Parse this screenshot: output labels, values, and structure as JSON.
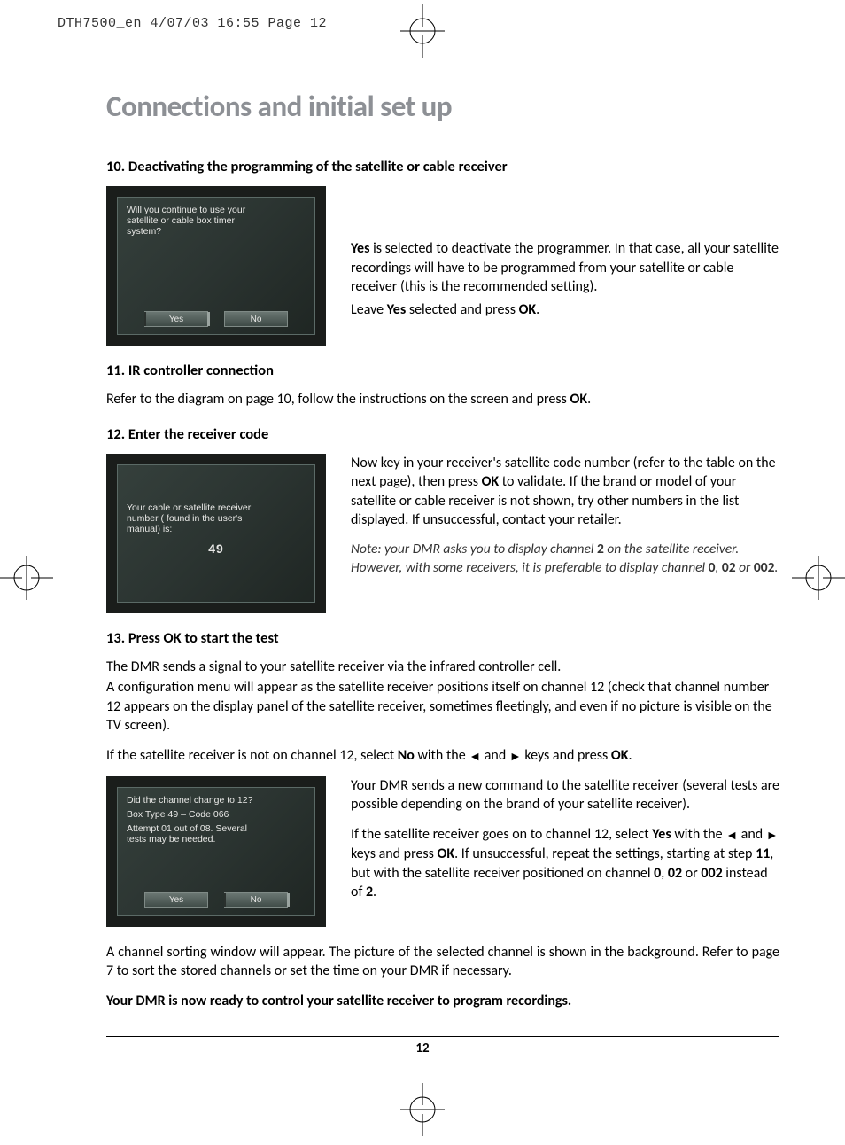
{
  "header": "DTH7500_en  4/07/03  16:55  Page 12",
  "title": "Connections and initial set up",
  "page_number": "12",
  "sec10": {
    "heading": "10. Deactivating the programming of the satellite or cable receiver",
    "tv_question": "Will you continue to use your\nsatellite or cable box timer\nsystem?",
    "btn_yes": "Yes",
    "btn_no": "No",
    "para_pre_yes": "Yes",
    "para_after_yes": " is selected to deactivate the programmer. In that case, all your satellite recordings will have to be programmed from your satellite or cable receiver (this is the recommended setting).",
    "para2_pre": "Leave ",
    "para2_yes": "Yes",
    "para2_mid": " selected and press ",
    "para2_ok": "OK",
    "para2_end": "."
  },
  "sec11": {
    "heading": "11. IR controller connection",
    "para_pre": "Refer to the diagram on page 10, follow the instructions on the screen and press ",
    "ok": "OK",
    "end": "."
  },
  "sec12": {
    "heading": "12. Enter the receiver code",
    "tv_text": "Your cable or satellite receiver\nnumber ( found in the user's\nmanual) is:",
    "tv_code": "49",
    "para_a": "Now key in your receiver's satellite code number (refer to the table on the next page), then press ",
    "ok": "OK",
    "para_b": " to validate. If the brand or model of your satellite or cable receiver is not shown, try other numbers in the list displayed. If unsuccessful, contact your retailer.",
    "note_a": "Note: your DMR asks you to display channel ",
    "note_2": "2",
    "note_b": " on the satellite receiver. However, with some receivers, it is preferable to display channel ",
    "note_0": "0",
    "note_c": ", ",
    "note_02": "02",
    "note_d": " or ",
    "note_002": "002",
    "note_e": "."
  },
  "sec13": {
    "heading": "13. Press OK to start the test",
    "p1": "The DMR sends a signal to your satellite receiver via the infrared controller cell.",
    "p2": "A configuration menu will appear as the satellite receiver positions itself on channel 12 (check that channel number 12 appears on the display panel of the satellite receiver, sometimes fleetingly, and even if no picture is visible on the TV screen).",
    "p3_a": "If the satellite receiver is not on channel 12, select ",
    "p3_no": "No",
    "p3_b": " with the ",
    "p3_c": " and ",
    "p3_d": " keys and press ",
    "p3_ok": "OK",
    "p3_e": ".",
    "tv_line1": "Did the channel change to 12?",
    "tv_line2": "Box Type 49 – Code 066",
    "tv_line3": "Attempt 01 out of 08. Several\ntests may be needed.",
    "btn_yes": "Yes",
    "btn_no": "No",
    "p4": "Your DMR sends a new command to the satellite receiver (several tests are possible depending on the brand of your satellite receiver).",
    "p5_a": "If the satellite receiver goes on to channel 12, select ",
    "p5_yes": "Yes",
    "p5_b": " with the ",
    "p5_c": " and ",
    "p5_d": " keys and press ",
    "p5_ok": "OK",
    "p5_e": ". If unsuccessful, repeat the settings, starting at step ",
    "p5_11": "11",
    "p5_f": ", but with the satellite receiver positioned on channel ",
    "p5_0": "0",
    "p5_g": ", ",
    "p5_02": "02",
    "p5_h": " or ",
    "p5_002": "002",
    "p5_i": " instead of ",
    "p5_2": "2",
    "p5_j": ".",
    "p6": "A channel sorting window will appear. The picture of the selected channel is shown in the background. Refer to page 7 to sort the stored channels or set the time on your DMR if necessary.",
    "p7": "Your DMR is now ready to control your satellite receiver to program recordings."
  }
}
